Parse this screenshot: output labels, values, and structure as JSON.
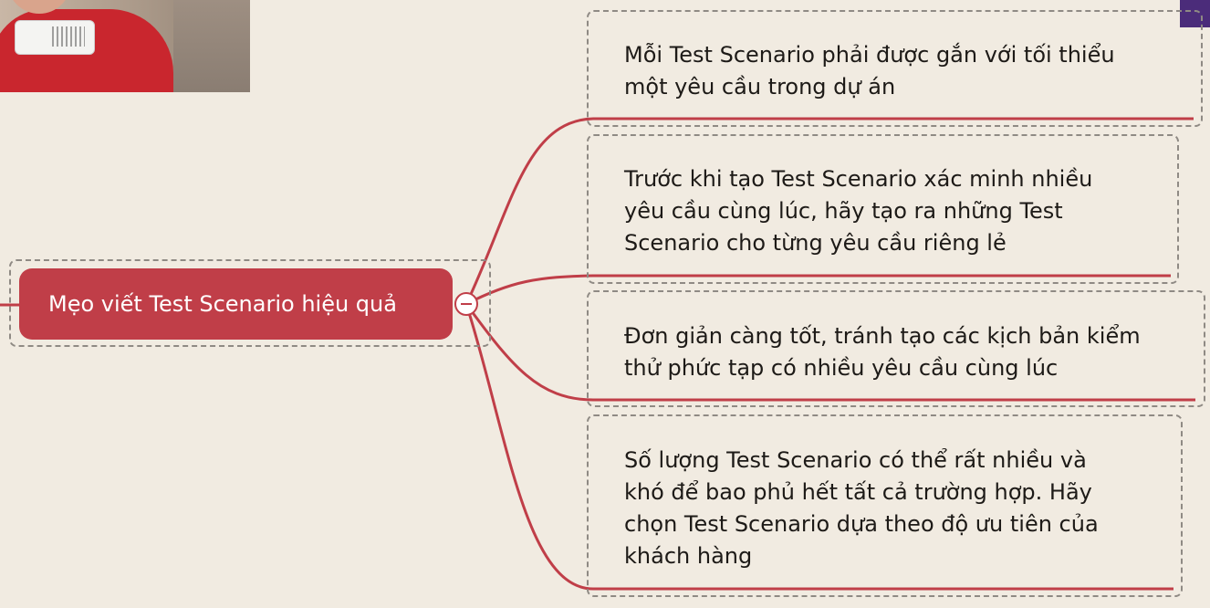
{
  "mindmap": {
    "root": {
      "label": "Mẹo viết Test Scenario hiệu quả",
      "color": "#c03e48"
    },
    "children": [
      {
        "text": "Mỗi Test Scenario phải được gắn với tối thiểu\nmột yêu cầu trong dự án"
      },
      {
        "text": "Trước khi tạo Test Scenario xác minh nhiều\nyêu cầu cùng lúc, hãy tạo ra những Test\nScenario cho từng yêu cầu riêng lẻ"
      },
      {
        "text": "Đơn giản càng tốt, tránh tạo các kịch bản kiểm\nthử phức tạp có nhiều yêu cầu cùng lúc"
      },
      {
        "text": "Số lượng Test Scenario có thể rất nhiều và\nkhó để bao phủ hết tất cả trường hợp. Hãy\nchọn Test Scenario dựa theo độ ưu tiên của\nkhách hàng"
      }
    ],
    "connector_color": "#c03e48",
    "background_color": "#f1ebe1"
  },
  "icons": {
    "collapse": "minus-circle-icon"
  }
}
